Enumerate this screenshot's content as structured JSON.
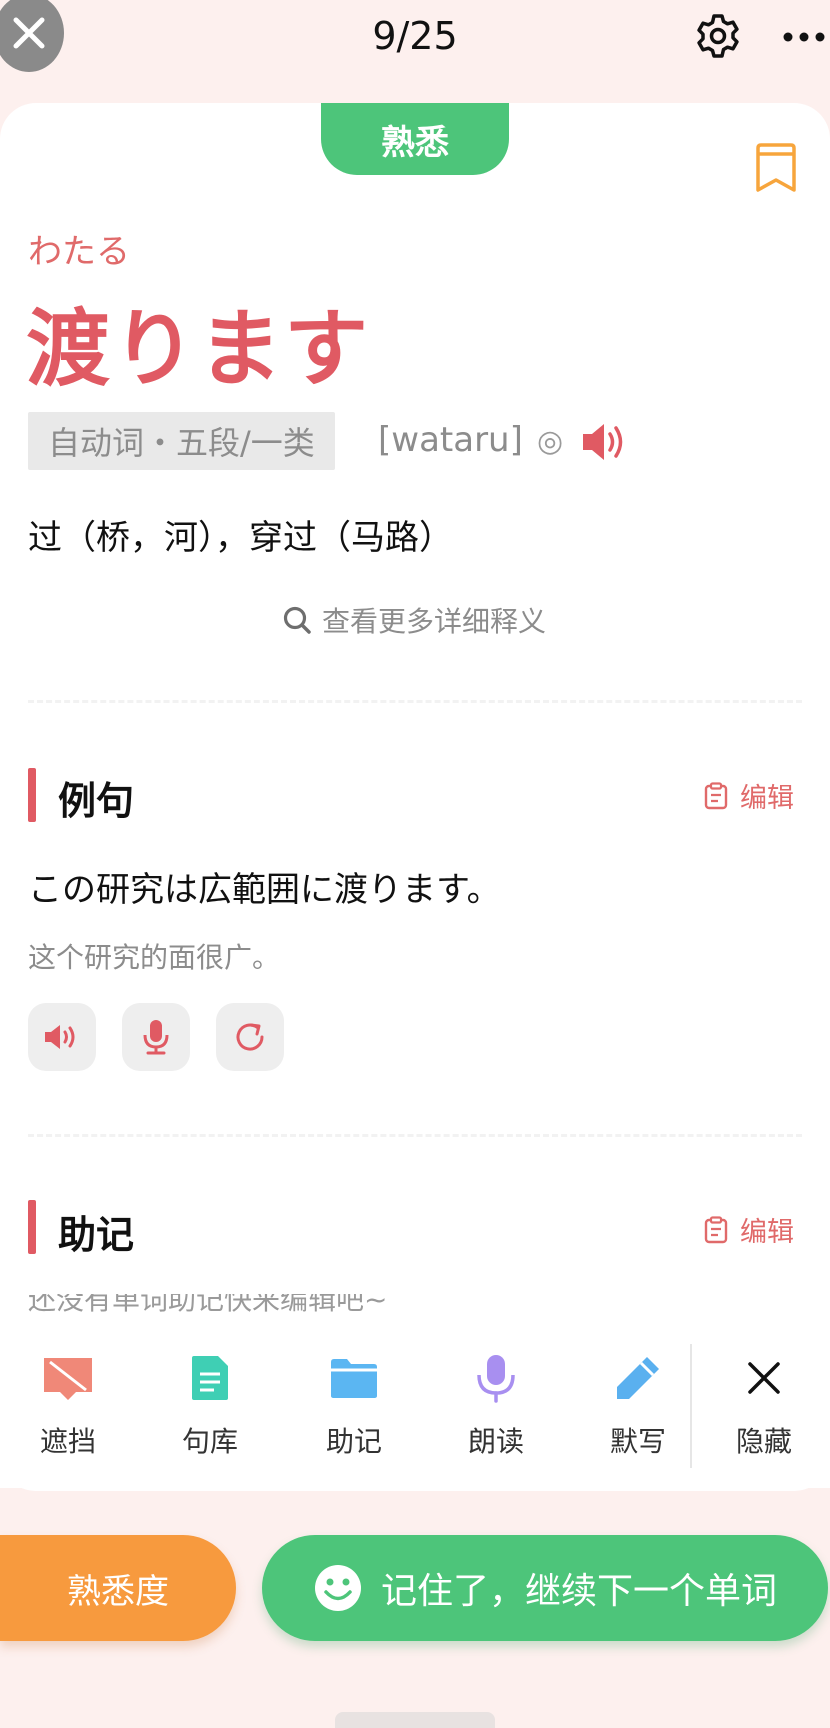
{
  "header": {
    "progress": "9/25",
    "settings_icon": "gear-icon",
    "more_icon": "more-icon"
  },
  "card": {
    "status": "熟悉",
    "reading": "わたる",
    "word": "渡ります",
    "pos": "自动词・五段/一类",
    "romaji": "[wataru]",
    "accent": "◎",
    "meaning": "过（桥，河），穿过（马路）",
    "more_detail": "查看更多详细释义"
  },
  "examples": {
    "title": "例句",
    "edit": "编辑",
    "sentence_jp": "この研究は広範囲に渡ります。",
    "sentence_cn": "这个研究的面很广。"
  },
  "mnemonic": {
    "title": "助记",
    "edit": "编辑",
    "placeholder": "还没有单词助记快来编辑吧~"
  },
  "toolbar": [
    {
      "label": "遮挡",
      "icon": "cover-icon",
      "color": "#f08878"
    },
    {
      "label": "句库",
      "icon": "document-icon",
      "color": "#3fcfb4"
    },
    {
      "label": "助记",
      "icon": "folder-icon",
      "color": "#5bb6f2"
    },
    {
      "label": "朗读",
      "icon": "microphone-icon",
      "color": "#a88ff0"
    },
    {
      "label": "默写",
      "icon": "pencil-icon",
      "color": "#5ab0ef"
    },
    {
      "label": "隐藏",
      "icon": "close-icon",
      "color": "#111111"
    }
  ],
  "footer": {
    "familiarity": "熟悉度",
    "next": "记住了，继续下一个单词"
  },
  "colors": {
    "accent_red": "#e05a63",
    "green": "#4dc57a",
    "orange": "#f79a3e"
  }
}
